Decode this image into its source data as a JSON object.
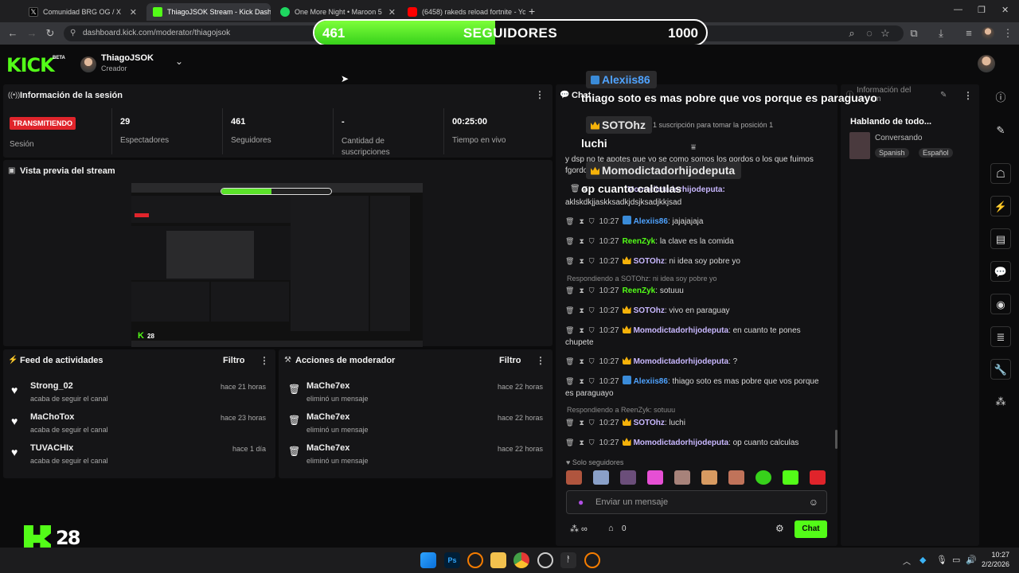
{
  "browser": {
    "tabs": [
      {
        "title": "Comunidad BRG OG / X",
        "active": false
      },
      {
        "title": "ThiagoJSOK Stream - Kick Dash",
        "active": true
      },
      {
        "title": "One More Night • Maroon 5",
        "active": false
      },
      {
        "title": "(6458) rakeds reload fortnite - Yo",
        "active": false
      }
    ],
    "url": "dashboard.kick.com/moderator/thiagojsok"
  },
  "goal": {
    "current": "461",
    "label": "SEGUIDORES",
    "target": "1000",
    "progress": 0.461
  },
  "header": {
    "logo": "KICK",
    "beta": "BETA",
    "username": "ThiagoJSOK",
    "role": "Creador"
  },
  "session": {
    "title": "Información de la sesión",
    "status": "TRANSMITIENDO",
    "status_label": "Sesión",
    "stats": [
      {
        "value": "29",
        "label": "Espectadores"
      },
      {
        "value": "461",
        "label": "Seguidores"
      },
      {
        "value": "-",
        "label": "Cantidad de suscripciones"
      },
      {
        "value": "00:25:00",
        "label": "Tiempo en vivo"
      }
    ]
  },
  "preview": {
    "title": "Vista previa del stream"
  },
  "feed": {
    "title": "Feed de actividades",
    "filter": "Filtro",
    "items": [
      {
        "name": "Strong_02",
        "action": "acaba de seguir el canal",
        "time": "hace 21 horas"
      },
      {
        "name": "MaChoTox",
        "action": "acaba de seguir el canal",
        "time": "hace 23 horas"
      },
      {
        "name": "TUVACHIx",
        "action": "acaba de seguir el canal",
        "time": "hace 1 día"
      }
    ]
  },
  "modactions": {
    "title": "Acciones de moderador",
    "filter": "Filtro",
    "items": [
      {
        "name": "MaChe7ex",
        "action": "eliminó un mensaje",
        "time": "hace 22 horas"
      },
      {
        "name": "MaChe7ex",
        "action": "eliminó un mensaje",
        "time": "hace 22 horas"
      },
      {
        "name": "MaChe7ex",
        "action": "eliminó un mensaje",
        "time": "hace 22 horas"
      }
    ]
  },
  "overlay_chat": [
    {
      "user": "Alexiis86",
      "msg": "thiago soto es mas pobre que vos porque es paraguayo",
      "color": "#4fa3ff"
    },
    {
      "user": "SOTOhz",
      "msg": "luchi",
      "color": "#ffffff"
    },
    {
      "user": "Momodictadorhijodeputa",
      "msg": "op cuanto calculas",
      "color": "#ffffff"
    }
  ],
  "chat": {
    "title": "Chat",
    "sub_text": "1 suscripción para tomar la posición 1",
    "partial_line": "y dsp no te apotes que yo se como somos los gordos o los que fuimos fgordos",
    "partial_user": "Momodictadorhijodeputa:",
    "partial_msg": "aklskdkjjaskksadkjdsjksadjkkjsad",
    "messages": [
      {
        "time": "10:27",
        "user": "Alexiis86",
        "text": "jajajajaja",
        "color": "#4fa3ff",
        "badge": "verif"
      },
      {
        "time": "10:27",
        "user": "ReenZyk",
        "text": "la clave es la comida",
        "color": "#53fc18",
        "badge": ""
      },
      {
        "time": "10:27",
        "user": "SOTOhz",
        "text": "ni idea soy pobre yo",
        "color": "#c9b8ff",
        "badge": "crown"
      },
      {
        "time": "10:27",
        "user": "ReenZyk",
        "text": "sotuuu",
        "color": "#53fc18",
        "badge": ""
      },
      {
        "time": "10:27",
        "user": "SOTOhz",
        "text": "vivo en paraguay",
        "color": "#c9b8ff",
        "badge": "crown"
      },
      {
        "time": "10:27",
        "user": "Momodictadorhijodeputa",
        "text": "en cuanto te pones chupete",
        "color": "#c9b8ff",
        "badge": "crown"
      },
      {
        "time": "10:27",
        "user": "Momodictadorhijodeputa",
        "text": "?",
        "color": "#c9b8ff",
        "badge": "crown"
      },
      {
        "time": "10:27",
        "user": "Alexiis86",
        "text": "thiago soto es mas pobre que vos porque es paraguayo",
        "color": "#4fa3ff",
        "badge": "verif"
      },
      {
        "time": "10:27",
        "user": "SOTOhz",
        "text": "luchi",
        "color": "#c9b8ff",
        "badge": "crown"
      },
      {
        "time": "10:27",
        "user": "Momodictadorhijodeputa",
        "text": "op cuanto calculas",
        "color": "#c9b8ff",
        "badge": "crown"
      }
    ],
    "replies": [
      "Respondiendo a SOTOhz: ni idea soy pobre yo",
      "Respondiendo a ReenZyk: sotuuu"
    ],
    "followers_only": "Solo seguidores",
    "placeholder": "Enviar un mensaje",
    "points": "0",
    "send_label": "Chat"
  },
  "stream_info": {
    "title": "Información del stream",
    "category": "Hablando de todo...",
    "tag1": "Conversando",
    "lang1": "Spanish",
    "lang2": "Español"
  },
  "overlay_logo": {
    "text": "28"
  },
  "taskbar": {
    "time": "10:27",
    "date": "2/2/2026"
  }
}
